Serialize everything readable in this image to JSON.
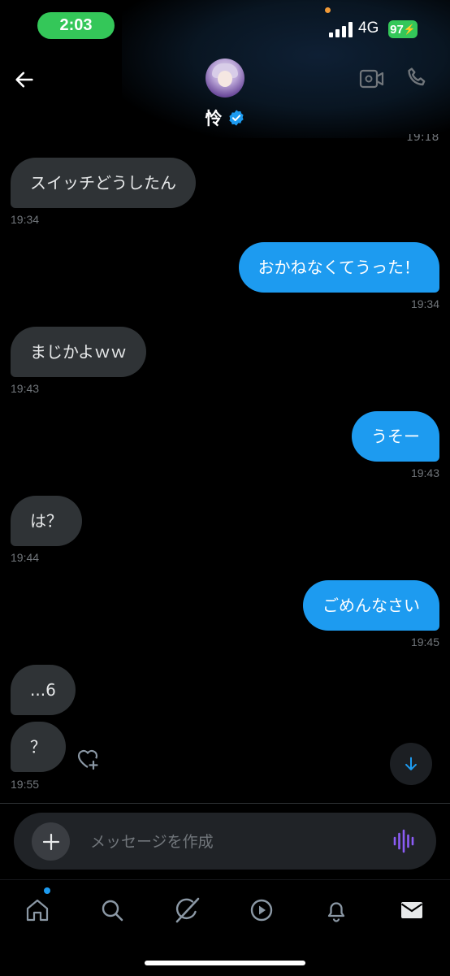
{
  "status": {
    "time": "2:03",
    "network": "4G",
    "battery": "97"
  },
  "header": {
    "name": "怜",
    "partial_timestamp": "19:18"
  },
  "messages": [
    {
      "side": "in",
      "text": "スイッチどうしたん",
      "time": "19:34"
    },
    {
      "side": "out",
      "text": "おかねなくてうった！",
      "time": "19:34"
    },
    {
      "side": "in",
      "text": "まじかよｗｗ",
      "time": "19:43"
    },
    {
      "side": "out",
      "text": "うそー",
      "time": "19:43"
    },
    {
      "side": "in",
      "text": "は？",
      "time": "19:44"
    },
    {
      "side": "out",
      "text": "ごめんなさい",
      "time": "19:45"
    },
    {
      "side": "in",
      "text": "...6"
    },
    {
      "side": "in",
      "text": "？",
      "time": "19:55"
    }
  ],
  "composer": {
    "placeholder": "メッセージを作成"
  },
  "tabs": [
    "home-icon",
    "search-icon",
    "grok-icon",
    "video-icon",
    "notifications-icon",
    "messages-icon"
  ],
  "colors": {
    "accent": "#1d9bf0",
    "incoming_bubble": "#2f3336",
    "status_green": "#34c759",
    "voice_purple": "#8b5cf6"
  }
}
